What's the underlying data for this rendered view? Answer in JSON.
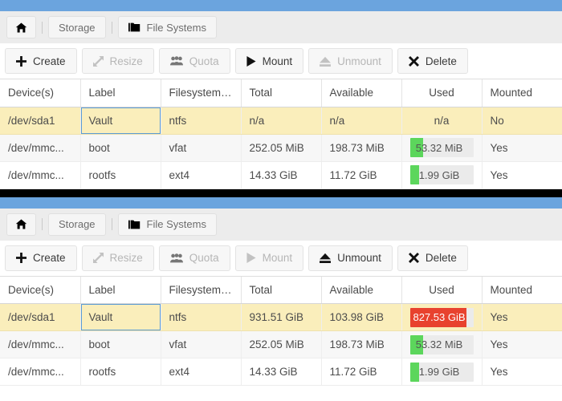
{
  "theme": {
    "header_blue": "#6ba4de",
    "divider_black": "#000000",
    "toolbar_bg": "#ececec",
    "selected_row": "#faeebb",
    "focus_border": "#5b9bd5",
    "bar_ok": "#5cd65c",
    "bar_danger": "#e8422e"
  },
  "breadcrumb": {
    "home_icon": "home-icon",
    "items": [
      {
        "label": "Storage",
        "icon": null
      },
      {
        "label": "File Systems",
        "icon": "folders-icon"
      }
    ]
  },
  "table": {
    "columns": [
      {
        "key": "devices",
        "label": "Device(s)",
        "align": "left"
      },
      {
        "key": "label",
        "label": "Label",
        "align": "left"
      },
      {
        "key": "filesystem",
        "label": "Filesystem ...",
        "align": "left"
      },
      {
        "key": "total",
        "label": "Total",
        "align": "left"
      },
      {
        "key": "available",
        "label": "Available",
        "align": "left"
      },
      {
        "key": "used",
        "label": "Used",
        "align": "center"
      },
      {
        "key": "mounted",
        "label": "Mounted",
        "align": "left"
      }
    ]
  },
  "panels": [
    {
      "id": "panel-before-mount",
      "toolbar": [
        {
          "label": "Create",
          "icon": "plus-icon",
          "enabled": true
        },
        {
          "label": "Resize",
          "icon": "resize-icon",
          "enabled": false
        },
        {
          "label": "Quota",
          "icon": "users-icon",
          "enabled": false
        },
        {
          "label": "Mount",
          "icon": "play-icon",
          "enabled": true
        },
        {
          "label": "Unmount",
          "icon": "eject-icon",
          "enabled": false
        },
        {
          "label": "Delete",
          "icon": "x-icon",
          "enabled": true
        }
      ],
      "rows": [
        {
          "state": "selected",
          "focused_cell": "label",
          "devices": "/dev/sda1",
          "label": "Vault",
          "filesystem": "ntfs",
          "total": "n/a",
          "available": "n/a",
          "used": {
            "text": "n/a",
            "bar": false
          },
          "mounted": "No"
        },
        {
          "state": "alt",
          "devices": "/dev/mmc...",
          "label": "boot",
          "filesystem": "vfat",
          "total": "252.05 MiB",
          "available": "198.73 MiB",
          "used": {
            "text": "53.32 MiB",
            "bar": true,
            "percent": 21,
            "level": "ok"
          },
          "mounted": "Yes"
        },
        {
          "state": "plain",
          "devices": "/dev/mmc...",
          "label": "rootfs",
          "filesystem": "ext4",
          "total": "14.33 GiB",
          "available": "11.72 GiB",
          "used": {
            "text": "1.99 GiB",
            "bar": true,
            "percent": 14,
            "level": "ok"
          },
          "mounted": "Yes"
        }
      ]
    },
    {
      "id": "panel-after-mount",
      "toolbar": [
        {
          "label": "Create",
          "icon": "plus-icon",
          "enabled": true
        },
        {
          "label": "Resize",
          "icon": "resize-icon",
          "enabled": false
        },
        {
          "label": "Quota",
          "icon": "users-icon",
          "enabled": false
        },
        {
          "label": "Mount",
          "icon": "play-icon",
          "enabled": false
        },
        {
          "label": "Unmount",
          "icon": "eject-icon",
          "enabled": true
        },
        {
          "label": "Delete",
          "icon": "x-icon",
          "enabled": true
        }
      ],
      "rows": [
        {
          "state": "selected",
          "focused_cell": "label",
          "devices": "/dev/sda1",
          "label": "Vault",
          "filesystem": "ntfs",
          "total": "931.51 GiB",
          "available": "103.98 GiB",
          "used": {
            "text": "827.53 GiB",
            "bar": true,
            "percent": 89,
            "level": "danger"
          },
          "mounted": "Yes"
        },
        {
          "state": "alt",
          "devices": "/dev/mmc...",
          "label": "boot",
          "filesystem": "vfat",
          "total": "252.05 MiB",
          "available": "198.73 MiB",
          "used": {
            "text": "53.32 MiB",
            "bar": true,
            "percent": 21,
            "level": "ok"
          },
          "mounted": "Yes"
        },
        {
          "state": "plain",
          "devices": "/dev/mmc...",
          "label": "rootfs",
          "filesystem": "ext4",
          "total": "14.33 GiB",
          "available": "11.72 GiB",
          "used": {
            "text": "1.99 GiB",
            "bar": true,
            "percent": 14,
            "level": "ok"
          },
          "mounted": "Yes"
        }
      ]
    }
  ]
}
